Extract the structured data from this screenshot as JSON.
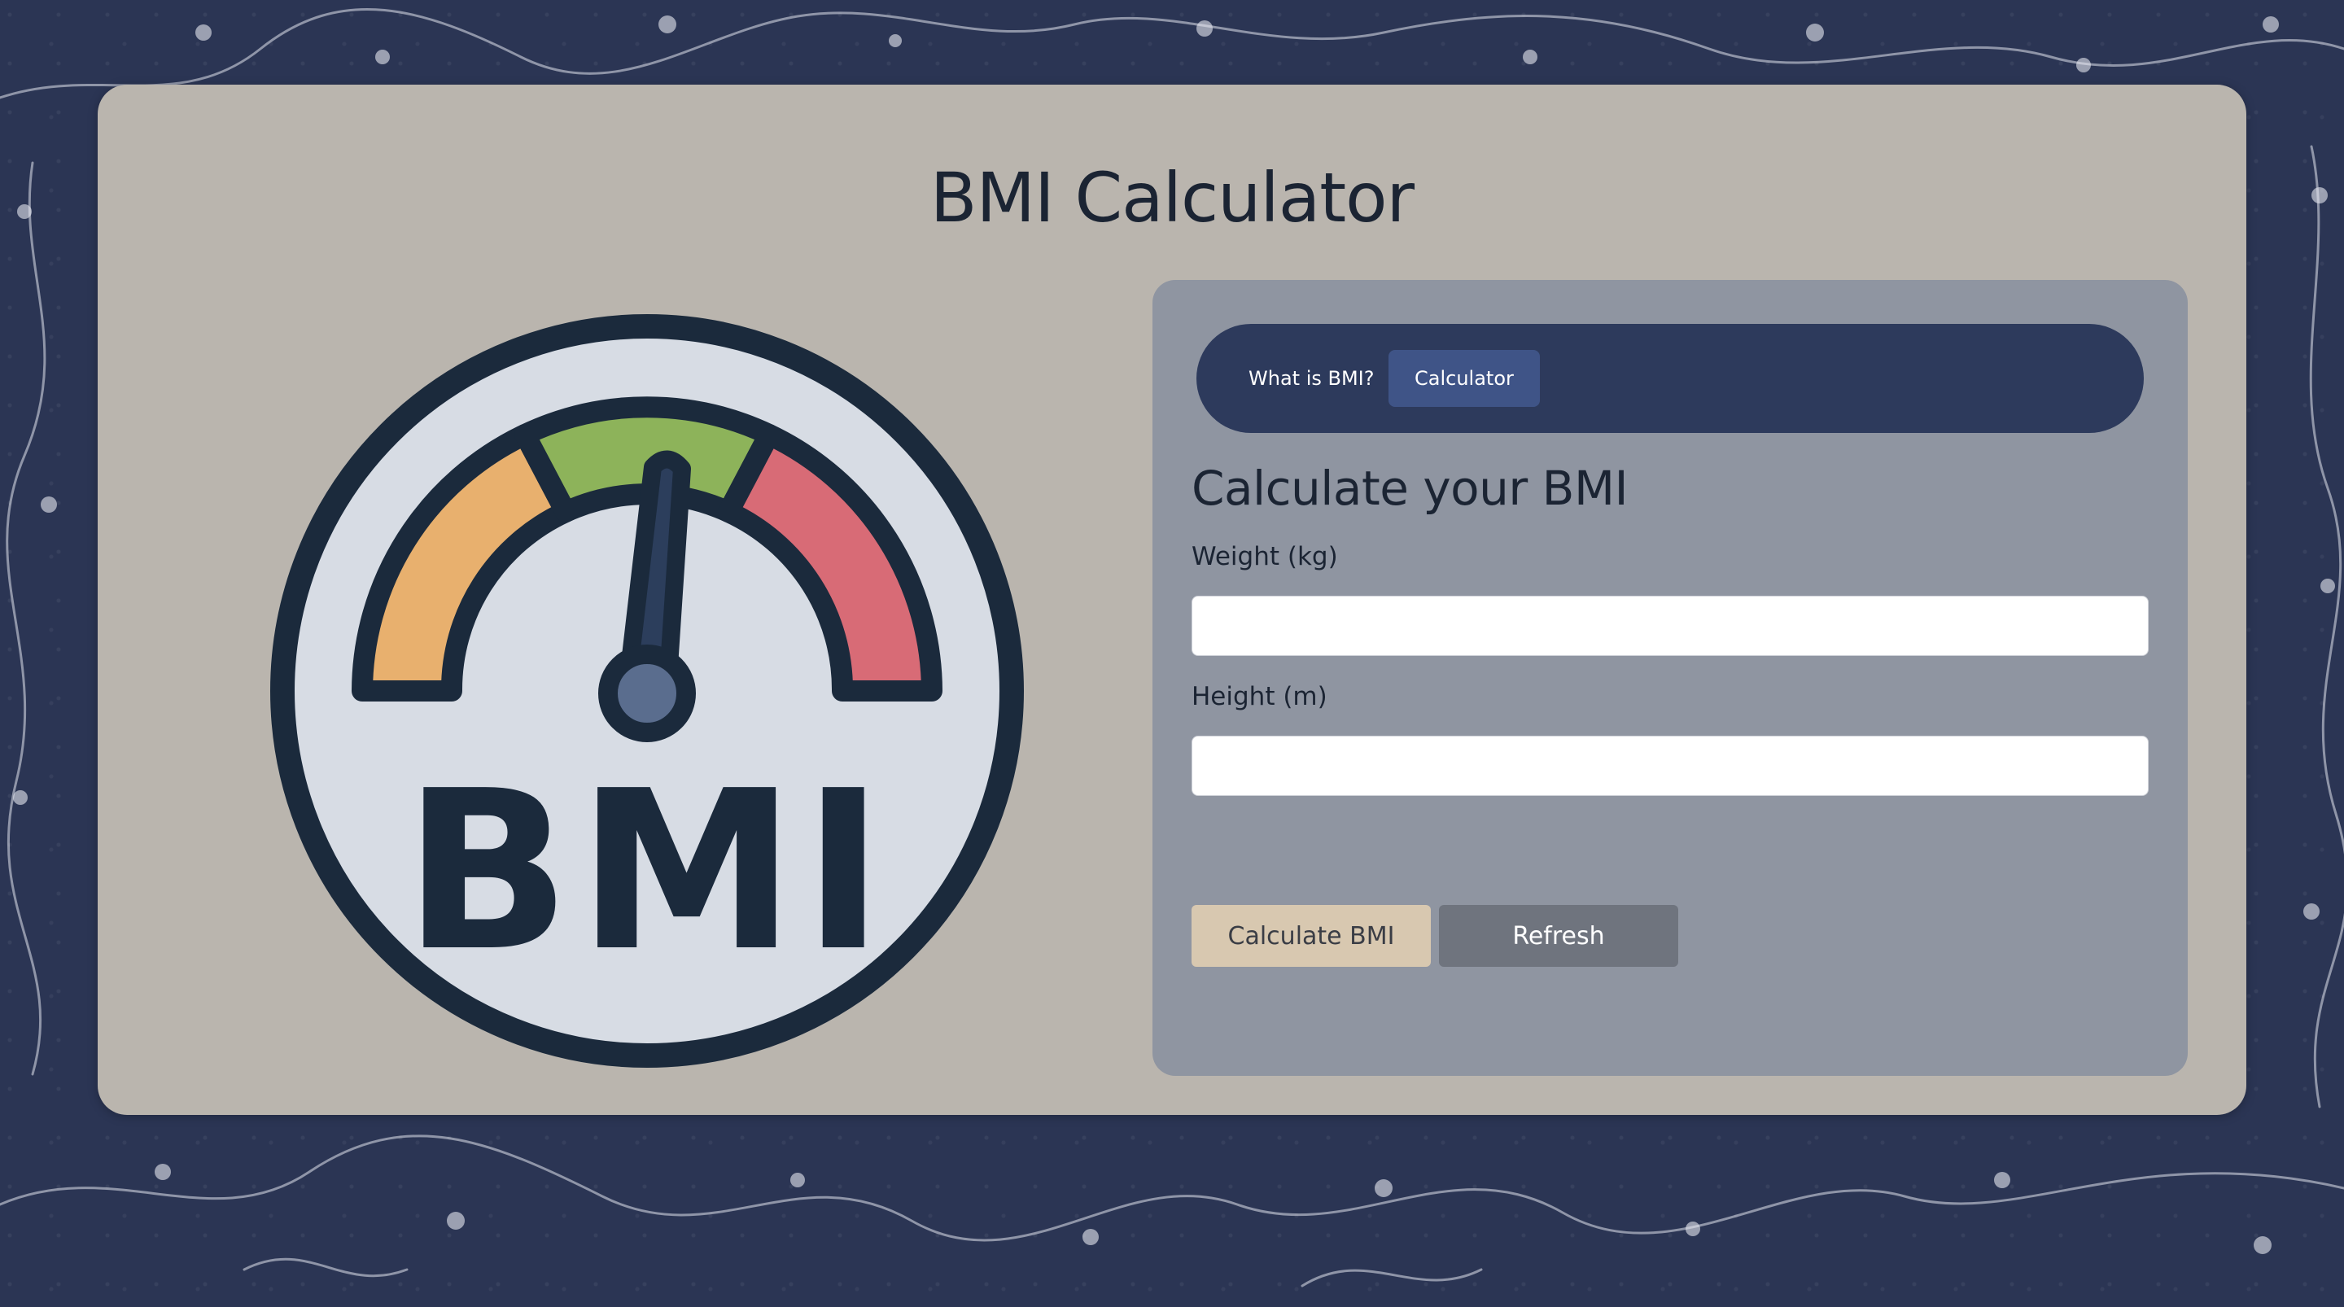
{
  "page": {
    "title": "BMI Calculator"
  },
  "logo": {
    "text": "BMI",
    "icon": "bmi-gauge-icon"
  },
  "nav": {
    "items": [
      {
        "label": "What is BMI?",
        "active": false
      },
      {
        "label": "Calculator",
        "active": true
      }
    ]
  },
  "form": {
    "title": "Calculate your BMI",
    "weight_label": "Weight (kg)",
    "weight_value": "",
    "height_label": "Height (m)",
    "height_value": "",
    "calculate_label": "Calculate BMI",
    "refresh_label": "Refresh"
  },
  "colors": {
    "background": "#2b3554",
    "card": "#bab5ae",
    "panel": "#8b92a0",
    "nav": "#2d3a5c",
    "nav_active": "#3f5487",
    "calculate_button": "#d8c8b0",
    "refresh_button": "#6f747e",
    "gauge_orange": "#e8b06e",
    "gauge_green": "#8db35a",
    "gauge_red": "#d86b76",
    "dark": "#1b2a3c"
  }
}
